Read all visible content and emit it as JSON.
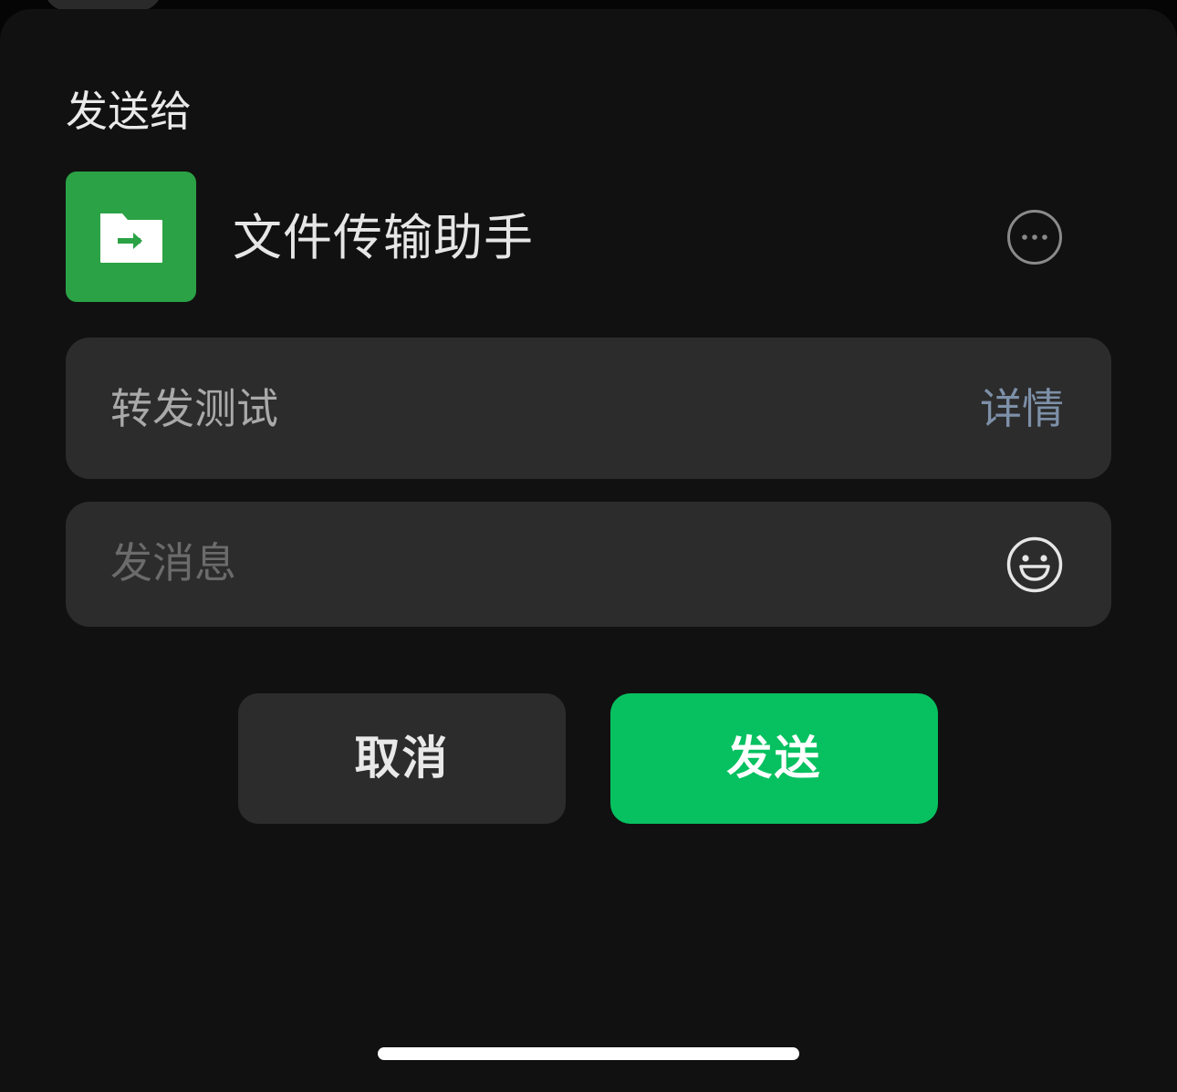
{
  "sheet": {
    "title": "发送给"
  },
  "recipient": {
    "name": "文件传输助手",
    "avatar_icon": "file-transfer-icon",
    "avatar_color": "#2ba245",
    "more_icon": "more-options-icon"
  },
  "preview": {
    "text": "转发测试",
    "detail_label": "详情"
  },
  "message": {
    "placeholder": "发消息",
    "value": "",
    "emoji_icon": "emoji-icon"
  },
  "actions": {
    "cancel_label": "取消",
    "send_label": "发送",
    "send_color": "#07c160"
  }
}
